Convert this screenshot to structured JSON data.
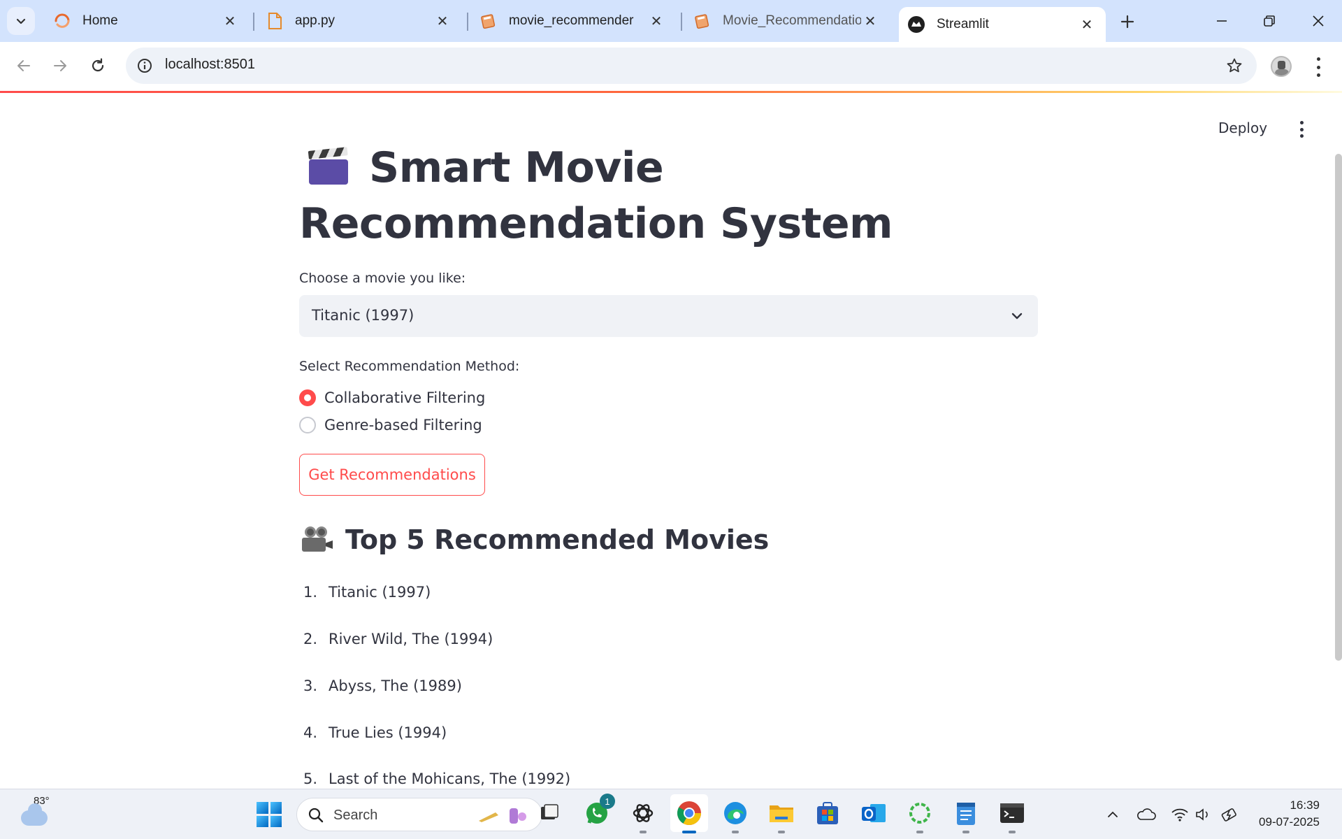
{
  "browser": {
    "tabs": [
      {
        "title": "Home",
        "icon": "loader-icon"
      },
      {
        "title": "app.py",
        "icon": "file-icon"
      },
      {
        "title": "movie_recommender",
        "icon": "notebook-icon"
      },
      {
        "title": "Movie_Recommendation_",
        "icon": "notebook-icon"
      },
      {
        "title": "Streamlit",
        "icon": "streamlit-icon",
        "active": true
      }
    ],
    "url": "localhost:8501"
  },
  "app": {
    "deploy_label": "Deploy",
    "title": "Smart Movie Recommendation System",
    "title_icon": "clapper-board-icon",
    "movie_select": {
      "label": "Choose a movie you like:",
      "value": "Titanic (1997)"
    },
    "method": {
      "label": "Select Recommendation Method:",
      "options": [
        "Collaborative Filtering",
        "Genre-based Filtering"
      ],
      "selected": "Collaborative Filtering"
    },
    "button_label": "Get Recommendations",
    "results": {
      "heading": "Top 5 Recommended Movies",
      "icon": "film-projector-icon",
      "items": [
        {
          "num": "1.",
          "title": "Titanic (1997)"
        },
        {
          "num": "2.",
          "title": "River Wild, The (1994)"
        },
        {
          "num": "3.",
          "title": "Abyss, The (1989)"
        },
        {
          "num": "4.",
          "title": "True Lies (1994)"
        },
        {
          "num": "5.",
          "title": "Last of the Mohicans, The (1992)"
        }
      ]
    }
  },
  "taskbar": {
    "weather": "83°",
    "search_placeholder": "Search",
    "whatsapp_badge": "1",
    "time": "16:39",
    "date": "09-07-2025"
  },
  "colors": {
    "accent": "#ff4b4b",
    "tabbar_bg": "#d3e3fd",
    "text": "#31333f"
  }
}
